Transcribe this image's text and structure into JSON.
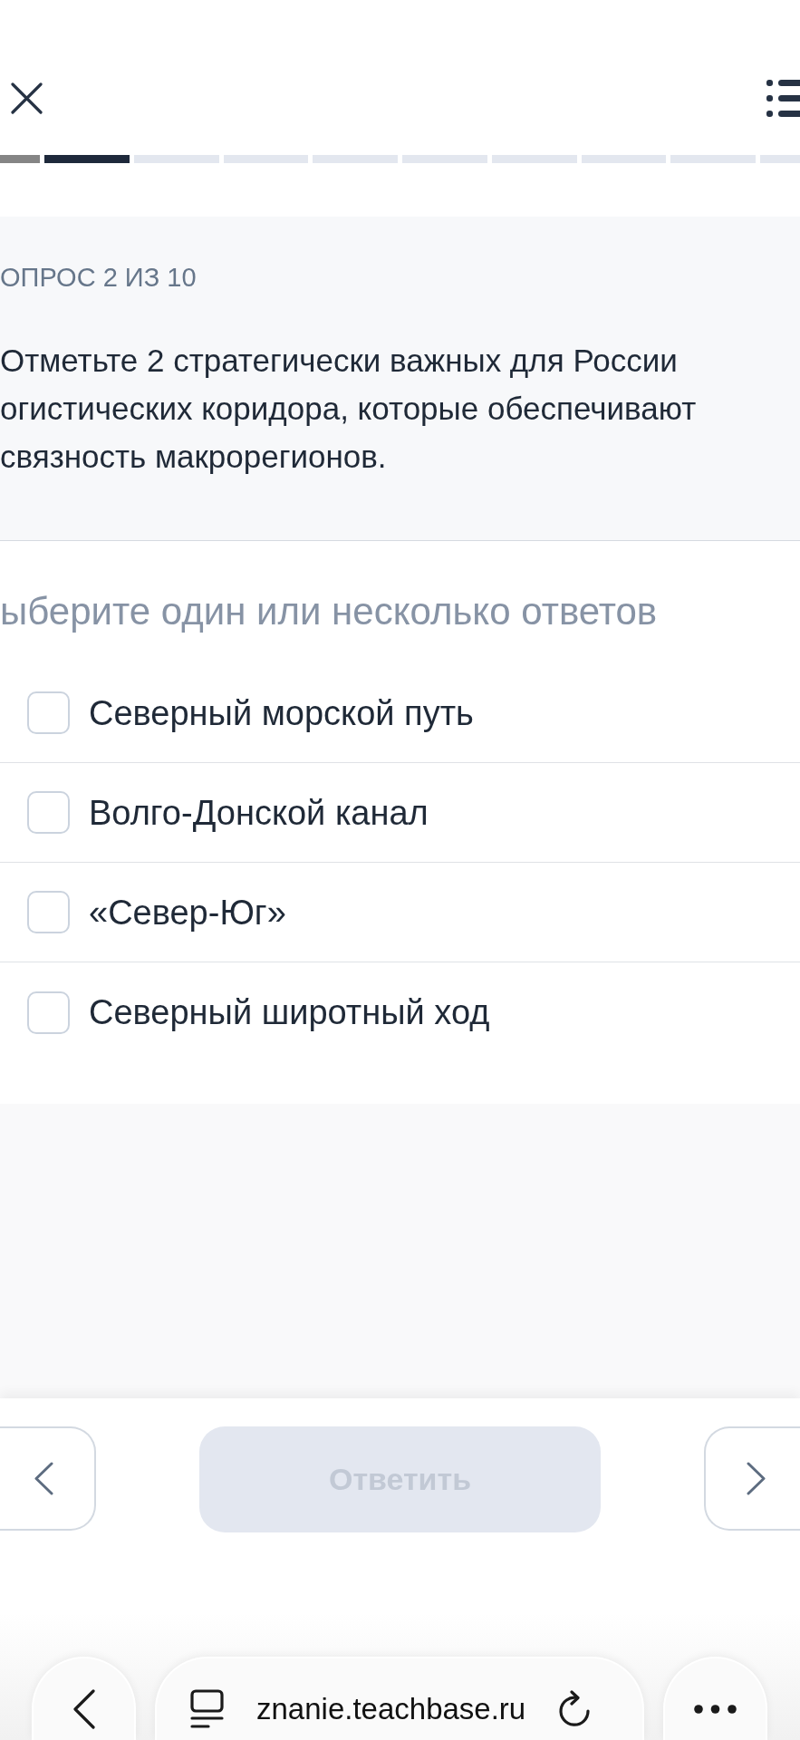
{
  "progress": {
    "segments": [
      {
        "completed": true,
        "selected": false
      },
      {
        "completed": false,
        "selected": true
      },
      {
        "completed": false,
        "selected": false
      },
      {
        "completed": false,
        "selected": false
      },
      {
        "completed": false,
        "selected": false
      },
      {
        "completed": false,
        "selected": false
      },
      {
        "completed": false,
        "selected": false
      },
      {
        "completed": false,
        "selected": false
      },
      {
        "completed": false,
        "selected": false
      },
      {
        "completed": false,
        "selected": false
      }
    ]
  },
  "question": {
    "counter": "ОПРОС 2 ИЗ 10",
    "text": "Отметьте 2 стратегически важных для России огистических коридора, которые обеспечивают связность макрорегионов."
  },
  "answers": {
    "instruction": "ыберите один или несколько ответов",
    "options": [
      {
        "label": "Северный морской путь",
        "checked": false
      },
      {
        "label": "Волго-Донской канал",
        "checked": false
      },
      {
        "label": "«Север-Юг»",
        "checked": false
      },
      {
        "label": "Северный широтный ход",
        "checked": false
      }
    ]
  },
  "answer_button": {
    "label": "Ответить",
    "disabled": true
  },
  "browser_bar": {
    "url": "znanie.teachbase.ru"
  }
}
